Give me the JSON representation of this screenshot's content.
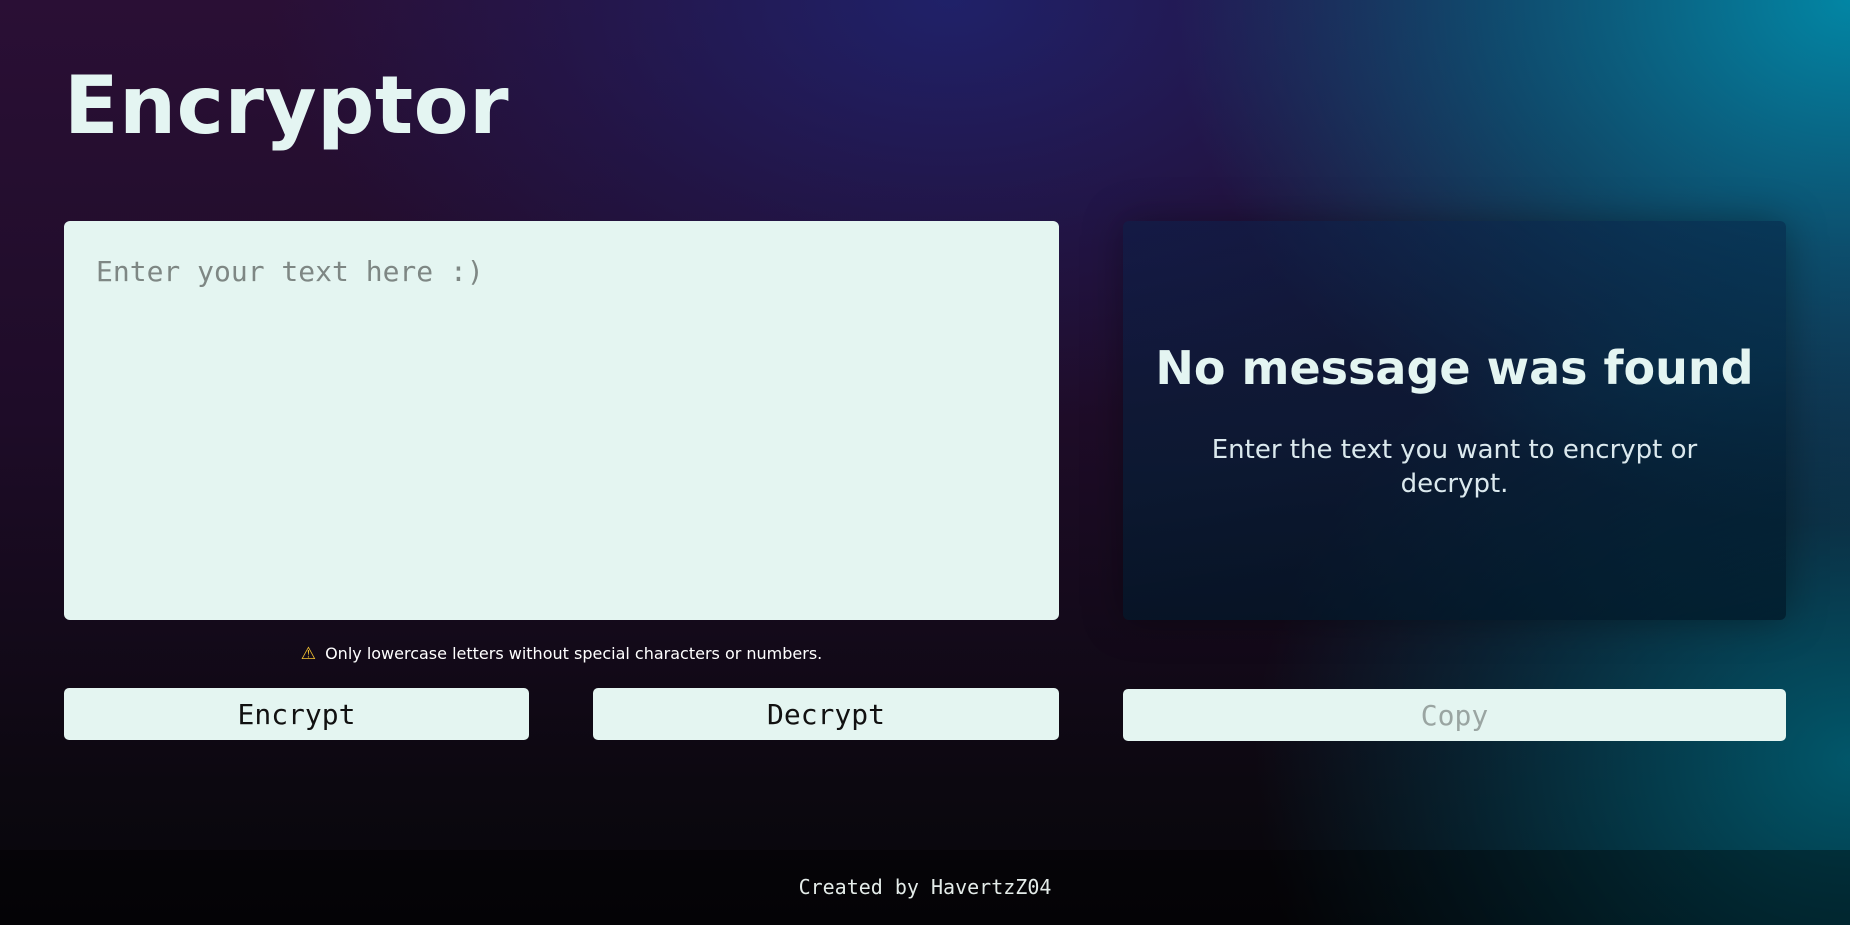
{
  "header": {
    "title": "Encryptor"
  },
  "input": {
    "placeholder": "Enter your text here :)",
    "value": ""
  },
  "warning": {
    "icon": "warning-icon",
    "text": "Only lowercase letters without special characters or numbers."
  },
  "buttons": {
    "encrypt_label": "Encrypt",
    "decrypt_label": "Decrypt",
    "copy_label": "Copy"
  },
  "output": {
    "title": "No message was found",
    "description": "Enter the text you want to encrypt or decrypt."
  },
  "footer": {
    "text": "Created by HavertzZ04"
  },
  "colors": {
    "panel_light": "#e4f5f1",
    "warning_icon": "#f5c431",
    "copy_disabled_text": "#9aa5a2"
  }
}
